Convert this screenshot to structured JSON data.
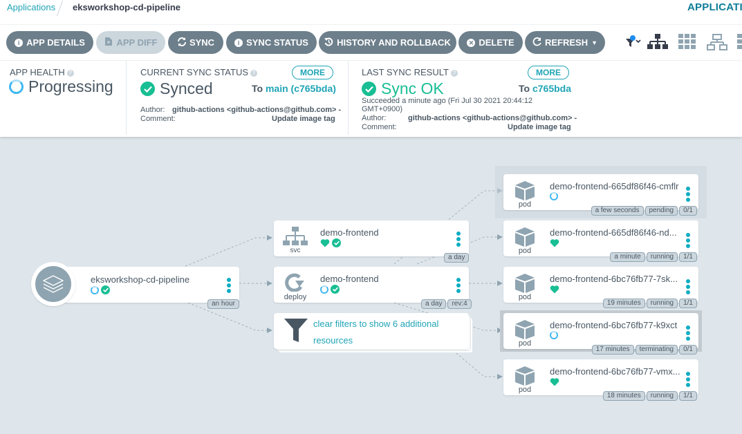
{
  "breadcrumb": {
    "root": "Applications",
    "current": "eksworkshop-cd-pipeline"
  },
  "top_right_label": "APPLICATIO",
  "toolbar": {
    "buttons": [
      {
        "label": "APP DETAILS",
        "icon": "info-circle-icon"
      },
      {
        "label": "APP DIFF",
        "icon": "file-diff-icon",
        "disabled": true
      },
      {
        "label": "SYNC",
        "icon": "sync-icon"
      },
      {
        "label": "SYNC STATUS",
        "icon": "info-circle-icon"
      },
      {
        "label": "HISTORY AND ROLLBACK",
        "icon": "history-icon"
      },
      {
        "label": "DELETE",
        "icon": "times-circle-icon"
      },
      {
        "label": "REFRESH",
        "icon": "redo-icon",
        "dropdown": true
      }
    ],
    "view_icons": [
      "filter-icon",
      "tree-view-icon",
      "pods-grid-icon",
      "network-view-icon",
      "list-view-icon"
    ]
  },
  "status": {
    "app_health": {
      "label": "APP HEALTH",
      "value": "Progressing"
    },
    "current_sync": {
      "label": "CURRENT SYNC STATUS",
      "value": "Synced",
      "more": "MORE",
      "to_prefix": "To",
      "to_rev": "main (c765bda)",
      "author_label": "Author:",
      "author": "github-actions <github-actions@github.com> -",
      "comment_label": "Comment:",
      "comment": "Update image tag"
    },
    "last_sync": {
      "label": "LAST SYNC RESULT",
      "value": "Sync OK",
      "more": "MORE",
      "to_prefix": "To",
      "to_rev": "c765bda",
      "succeeded_line1": "Succeeded a minute ago (Fri Jul 30 2021 20:44:12",
      "succeeded_line2": "GMT+0900)",
      "author_label": "Author:",
      "author": "github-actions <github-actions@github.com> -",
      "comment_label": "Comment:",
      "comment": "Update image tag"
    }
  },
  "graph": {
    "app_node": {
      "name": "eksworkshop-cd-pipeline",
      "tags": [
        "an hour"
      ]
    },
    "svc_node": {
      "name": "demo-frontend",
      "kind": "svc",
      "tags": [
        "a day"
      ]
    },
    "deploy_node": {
      "name": "demo-frontend",
      "kind": "deploy",
      "tags": [
        "a day",
        "rev:4"
      ]
    },
    "filter_node": {
      "line1": "clear filters to show 6 additional",
      "line2": "resources"
    },
    "pods": [
      {
        "name": "demo-frontend-665df86f46-cmflr",
        "kind": "pod",
        "health": "progressing",
        "tags": [
          "a few seconds",
          "pending",
          "0/1"
        ],
        "highlighted": true
      },
      {
        "name": "demo-frontend-665df86f46-nd...",
        "kind": "pod",
        "health": "healthy",
        "tags": [
          "a minute",
          "running",
          "1/1"
        ]
      },
      {
        "name": "demo-frontend-6bc76fb77-7sk...",
        "kind": "pod",
        "health": "healthy",
        "tags": [
          "19 minutes",
          "running",
          "1/1"
        ]
      },
      {
        "name": "demo-frontend-6bc76fb77-k9xct",
        "kind": "pod",
        "health": "progressing",
        "tags": [
          "17 minutes",
          "terminating",
          "0/1"
        ],
        "selected": true
      },
      {
        "name": "demo-frontend-6bc76fb77-vmx...",
        "kind": "pod",
        "health": "healthy",
        "tags": [
          "18 minutes",
          "running",
          "1/1"
        ]
      }
    ]
  },
  "colors": {
    "accent": "#1fa4b6",
    "button": "#6d7f8b",
    "healthy": "#18be94",
    "progressing": "#41b8f0",
    "background": "#dee6eb"
  }
}
